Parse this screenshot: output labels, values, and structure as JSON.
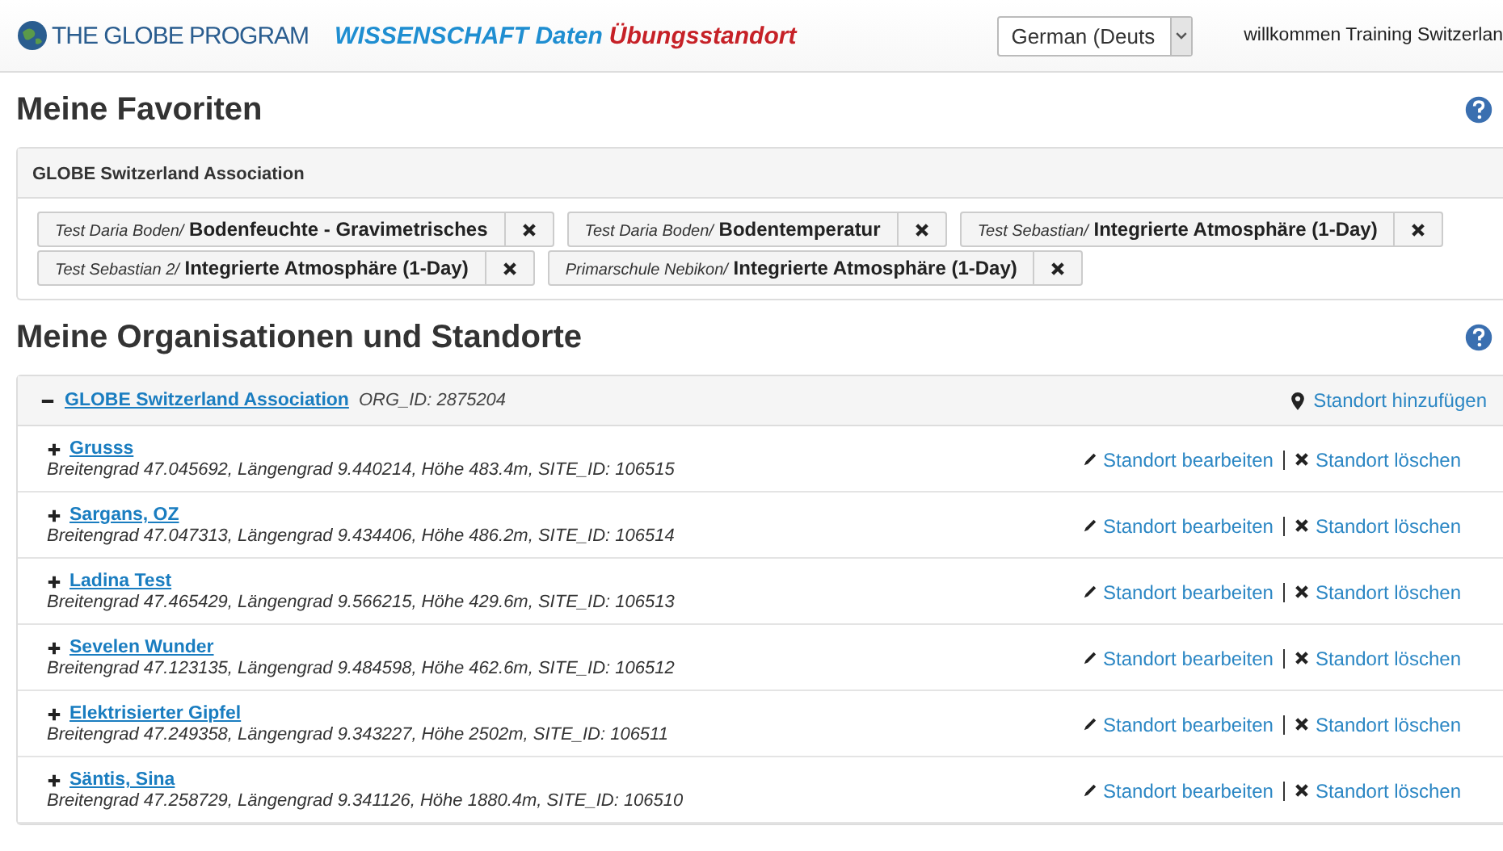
{
  "header": {
    "logo": "THE GLOBE PROGRAM",
    "title": "WISSENSCHAFT Daten",
    "subtitle": "Übungsstandort",
    "language": "German (Deuts",
    "welcome": "willkommen Training Switzerlan"
  },
  "favorites": {
    "heading": "Meine Favoriten",
    "group": "GLOBE Switzerland Association",
    "items": [
      {
        "site": "Test Daria Boden/",
        "protocol": "Bodenfeuchte - Gravimetrisches"
      },
      {
        "site": "Test Daria Boden/",
        "protocol": "Bodentemperatur"
      },
      {
        "site": "Test Sebastian/",
        "protocol": "Integrierte Atmosphäre (1-Day)"
      },
      {
        "site": "Test Sebastian 2/",
        "protocol": "Integrierte Atmosphäre (1-Day)"
      },
      {
        "site": "Primarschule Nebikon/",
        "protocol": "Integrierte Atmosphäre (1-Day)"
      }
    ]
  },
  "organizations": {
    "heading": "Meine Organisationen und Standorte",
    "org": {
      "name": "GLOBE Switzerland Association",
      "org_id": "ORG_ID: 2875204",
      "expanded": true,
      "add_site": "Standort hinzufügen"
    },
    "sites": [
      {
        "name": "Grusss",
        "details": "Breitengrad 47.045692, Längengrad 9.440214, Höhe 483.4m, SITE_ID: 106515",
        "edit": "Standort bearbeiten",
        "delete": "Standort löschen"
      },
      {
        "name": "Sargans, OZ",
        "details": "Breitengrad 47.047313, Längengrad 9.434406, Höhe 486.2m, SITE_ID: 106514",
        "edit": "Standort bearbeiten",
        "delete": "Standort löschen"
      },
      {
        "name": "Ladina Test",
        "details": "Breitengrad 47.465429, Längengrad 9.566215, Höhe 429.6m, SITE_ID: 106513",
        "edit": "Standort bearbeiten",
        "delete": "Standort löschen"
      },
      {
        "name": "Sevelen Wunder",
        "details": "Breitengrad 47.123135, Längengrad 9.484598, Höhe 462.6m, SITE_ID: 106512",
        "edit": "Standort bearbeiten",
        "delete": "Standort löschen"
      },
      {
        "name": "Elektrisierter Gipfel",
        "details": "Breitengrad 47.249358, Längengrad 9.343227, Höhe 2502m, SITE_ID: 106511",
        "edit": "Standort bearbeiten",
        "delete": "Standort löschen"
      },
      {
        "name": "Säntis, Sina",
        "details": "Breitengrad 47.258729, Längengrad 9.341126, Höhe 1880.4m, SITE_ID: 106510",
        "edit": "Standort bearbeiten",
        "delete": "Standort löschen"
      }
    ]
  }
}
